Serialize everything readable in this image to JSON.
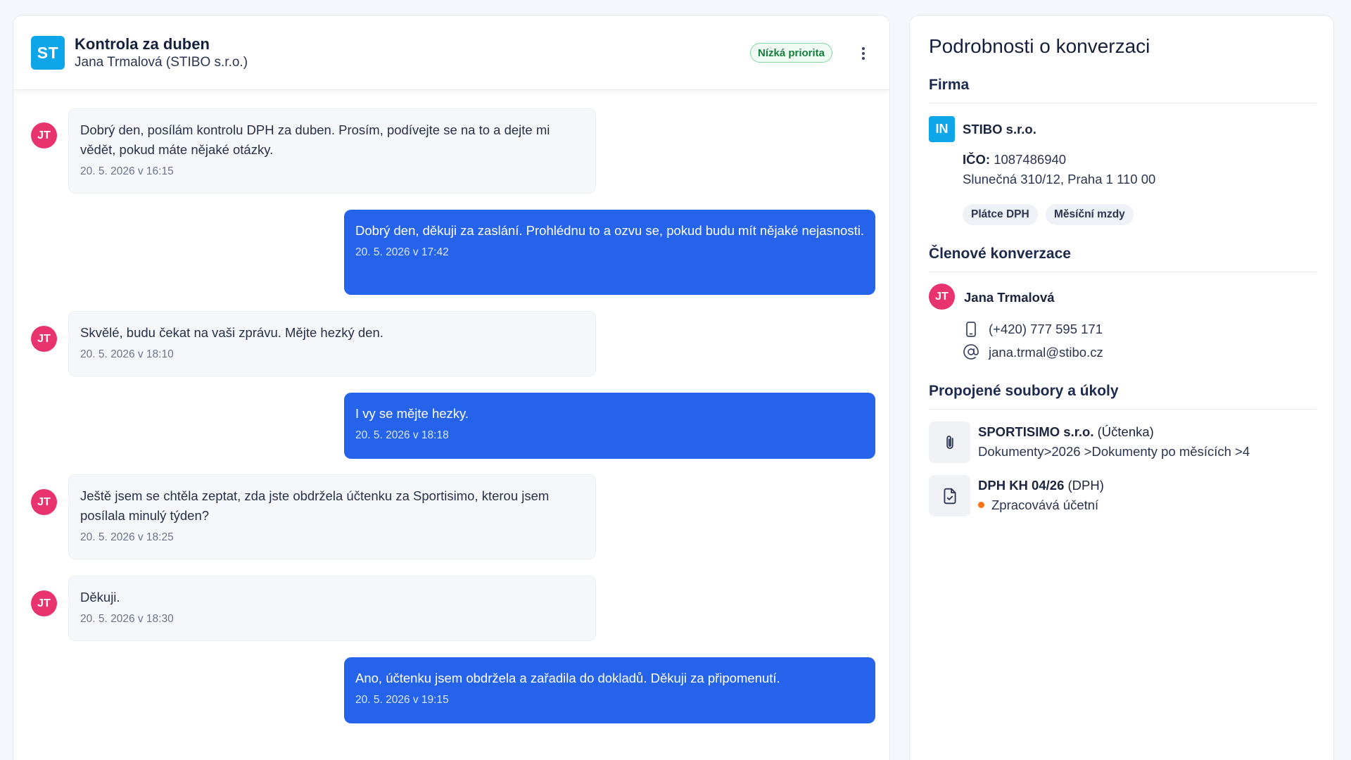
{
  "conversation": {
    "avatar": "ST",
    "title": "Kontrola za duben",
    "subtitle": "Jana Trmalová (STIBO s.r.o.)",
    "priority": "Nízká priorita"
  },
  "messages": [
    {
      "direction": "in",
      "avatar": "JT",
      "text": "Dobrý den, posílám kontrolu DPH za duben. Prosím, podívejte se na to a dejte mi vědět, pokud máte nějaké otázky.",
      "time": "20. 5. 2026 v 16:15"
    },
    {
      "direction": "out",
      "text": "Dobrý den, děkuji za zaslání. Prohlédnu to a ozvu se, pokud budu mít nějaké nejasnosti.",
      "time": "20. 5. 2026 v 17:42"
    },
    {
      "direction": "in",
      "avatar": "JT",
      "text": "Skvělé, budu čekat na vaši zprávu. Mějte hezký den.",
      "time": "20. 5. 2026 v 18:10"
    },
    {
      "direction": "out",
      "text": "I vy se mějte hezky.",
      "time": "20. 5. 2026 v 18:18"
    },
    {
      "direction": "in",
      "avatar": "JT",
      "text": "Ještě jsem se chtěla zeptat, zda jste obdržela účtenku za Sportisimo, kterou jsem posílala minulý týden?",
      "time": "20. 5. 2026 v 18:25"
    },
    {
      "direction": "in",
      "avatar": "JT",
      "text": "Děkuji.",
      "time": "20. 5. 2026 v 18:30"
    },
    {
      "direction": "out",
      "text": "Ano, účtenku jsem obdržela a zařadila do dokladů. Děkuji za připomenutí.",
      "time": "20. 5. 2026 v 19:15"
    }
  ],
  "details": {
    "title": "Podrobnosti o konverzaci",
    "company": {
      "section_title": "Firma",
      "logo": "IN",
      "name": "STIBO s.r.o.",
      "ico_label": "IČO:",
      "ico": "1087486940",
      "address": "Slunečná 310/12, Praha 1 110 00",
      "tags": [
        "Plátce DPH",
        "Měsíční mzdy"
      ]
    },
    "members": {
      "section_title": "Členové konverzace",
      "avatar": "JT",
      "name": "Jana Trmalová",
      "phone": "(+420) 777 595 171",
      "email": "jana.trmal@stibo.cz"
    },
    "linked": {
      "section_title": "Propojené soubory a úkoly",
      "items": [
        {
          "icon": "paperclip-icon",
          "title": "SPORTISIMO s.r.o.",
          "type": "(Účtenka)",
          "detail": "Dokumenty>2026 >Dokumenty po měsících >4"
        },
        {
          "icon": "document-check-icon",
          "title": "DPH KH 04/26",
          "type": "(DPH)",
          "status": "Zpracovává účetní",
          "status_color": "#f97316"
        }
      ]
    }
  },
  "colors": {
    "accent": "#2563eb",
    "avatar_pink": "#e8336f",
    "brand_cyan": "#0ea5e9",
    "priority_green": "#15803d"
  }
}
